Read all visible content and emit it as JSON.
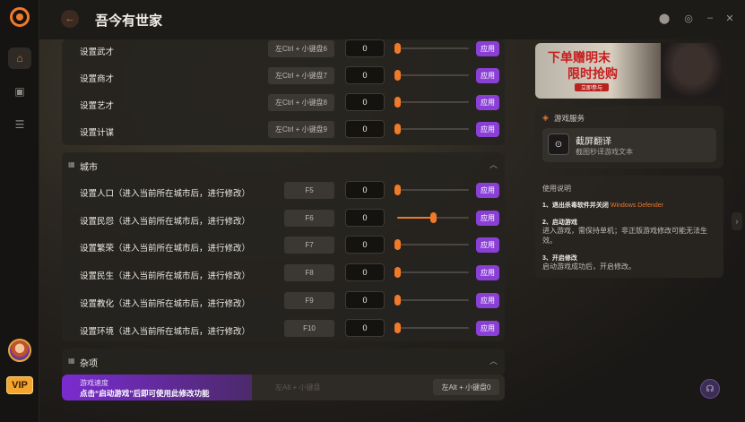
{
  "app": {
    "title": "吾今有世家"
  },
  "window_controls": [
    {
      "name": "settings-icon",
      "glyph": "⬤"
    },
    {
      "name": "refresh-icon",
      "glyph": "◎"
    },
    {
      "name": "minimize-icon",
      "glyph": "–"
    },
    {
      "name": "close-icon",
      "glyph": "✕"
    }
  ],
  "sidebar": {
    "items": [
      {
        "name": "home-icon"
      },
      {
        "name": "gamepad-icon"
      },
      {
        "name": "storage-icon"
      }
    ],
    "vip": "VIP"
  },
  "top_rows": [
    {
      "label": "设置武才",
      "hotkey": "左Ctrl + 小键盘6",
      "value": "0",
      "level": 0,
      "apply": "应用"
    },
    {
      "label": "设置商才",
      "hotkey": "左Ctrl + 小键盘7",
      "value": "0",
      "level": 0,
      "apply": "应用"
    },
    {
      "label": "设置艺才",
      "hotkey": "左Ctrl + 小键盘8",
      "value": "0",
      "level": 0,
      "apply": "应用"
    },
    {
      "label": "设置计谋",
      "hotkey": "左Ctrl + 小键盘9",
      "value": "0",
      "level": 0,
      "apply": "应用"
    }
  ],
  "city": {
    "title": "城市",
    "rows": [
      {
        "label": "设置人口（进入当前所在城市后，进行修改）",
        "hotkey": "F5",
        "value": "0",
        "level": 0,
        "apply": "应用"
      },
      {
        "label": "设置民怨（进入当前所在城市后，进行修改）",
        "hotkey": "F6",
        "value": "0",
        "level": 0.5,
        "apply": "应用"
      },
      {
        "label": "设置繁荣（进入当前所在城市后，进行修改）",
        "hotkey": "F7",
        "value": "0",
        "level": 0,
        "apply": "应用"
      },
      {
        "label": "设置民生（进入当前所在城市后，进行修改）",
        "hotkey": "F8",
        "value": "0",
        "level": 0,
        "apply": "应用"
      },
      {
        "label": "设置教化（进入当前所在城市后，进行修改）",
        "hotkey": "F9",
        "value": "0",
        "level": 0,
        "apply": "应用"
      },
      {
        "label": "设置环境（进入当前所在城市后，进行修改）",
        "hotkey": "F10",
        "value": "0",
        "level": 0,
        "apply": "应用"
      }
    ]
  },
  "misc": {
    "title": "杂项",
    "speed_hotkey_hidden": "左Alt + 小键盘",
    "speed_hotkey": "左Alt + 小键盘0",
    "promo_title": "游戏速度",
    "promo_text": "点击“启动游戏”后即可使用此修改功能"
  },
  "banner": {
    "line1": "下单赠明末",
    "line2": "限时抢购",
    "button": "立即参与"
  },
  "game_service": {
    "title": "游戏服务",
    "item_title": "截屏翻译",
    "item_desc": "截图秒译游戏文本"
  },
  "instructions": {
    "title": "使用说明",
    "step1_title": "1、退出杀毒软件并关闭",
    "step1_highlight": "Windows Defender",
    "step2_title": "2、启动游戏",
    "step2_text": "进入游戏，需保持单机；非正版游戏修改可能无法生效。",
    "step3_title": "3、开启修改",
    "step3_text": "启动游戏成功后，开启修改。"
  },
  "colors": {
    "accent": "#f07a2a",
    "apply": "#8a3fd6",
    "highlight": "#e8752b"
  }
}
